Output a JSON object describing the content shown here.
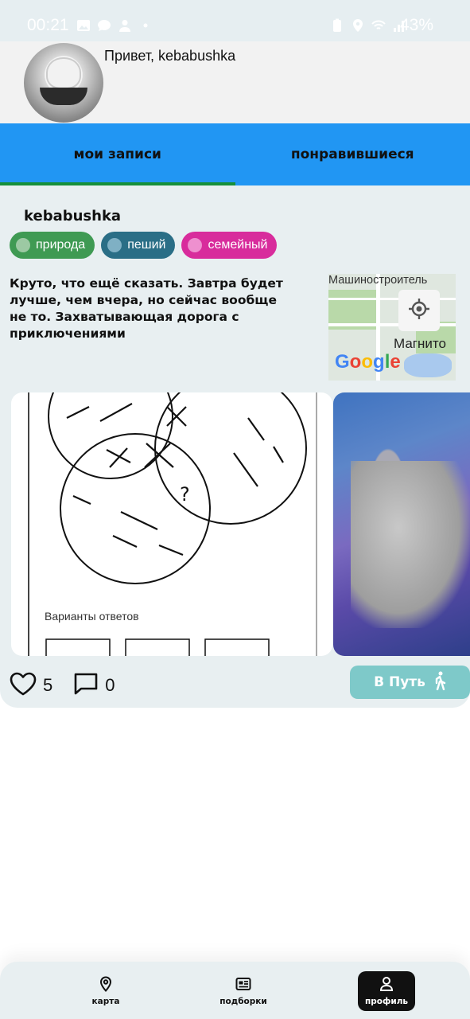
{
  "status_bar": {
    "time": "00:21",
    "battery": "43%",
    "left_icons": [
      "image-icon",
      "chat-icon",
      "person-icon",
      "dot-icon"
    ],
    "right_icons": [
      "battery-saver-icon",
      "location-icon",
      "wifi-call-icon",
      "signal-icon"
    ]
  },
  "header": {
    "greeting": "Привет, kebabushka"
  },
  "tabs": [
    {
      "label": "мои записи",
      "active": true
    },
    {
      "label": "понравившиеся",
      "active": false
    }
  ],
  "post": {
    "author": "kebabushka",
    "tags": [
      {
        "label": "природа",
        "color": "#3f9a53"
      },
      {
        "label": "пеший",
        "color": "#2a6e86"
      },
      {
        "label": "семейный",
        "color": "#d82c9c"
      }
    ],
    "text": "Круто, что ещё сказать. Завтра будет лучше, чем вчера, но сейчас вообще не то. Захватывающая дорога с приключениями",
    "map": {
      "label_top": "Машиностроитель",
      "label_city": "Магнито",
      "brand": "Google"
    },
    "image1_caption": "Варианты ответов",
    "likes": "5",
    "comments": "0",
    "go_button": "В Путь"
  },
  "bottom_nav": [
    {
      "label": "карта",
      "icon": "map-pin-icon"
    },
    {
      "label": "подборки",
      "icon": "collection-icon"
    },
    {
      "label": "профиль",
      "icon": "profile-icon",
      "active": true
    }
  ],
  "colors": {
    "tab_bar": "#2196f3",
    "active_tab_indicator": "#158f3a",
    "card_background": "#e8eff1",
    "go_button": "#7ec9c9"
  }
}
